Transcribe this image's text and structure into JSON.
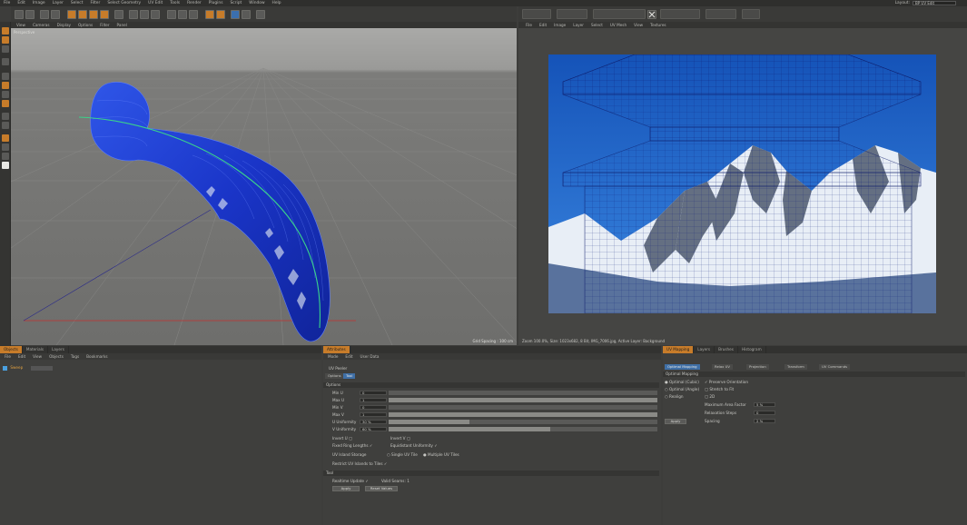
{
  "menubar": {
    "items": [
      "File",
      "Edit",
      "Image",
      "Layer",
      "Select",
      "Filter",
      "Select Geometry",
      "UV Edit",
      "Tools",
      "Render",
      "Plugins",
      "Script",
      "Window",
      "Help"
    ],
    "layout_label": "Layout:",
    "layout_value": "BP UV Edit"
  },
  "viewport": {
    "menu": [
      "View",
      "Cameras",
      "Display",
      "Options",
      "Filter",
      "Panel"
    ],
    "label": "Perspective",
    "grid_spacing": "Grid Spacing : 100 cm"
  },
  "uv_editor": {
    "menu": [
      "File",
      "Edit",
      "Image",
      "Layer",
      "Select",
      "UV Mesh",
      "View",
      "Textures"
    ],
    "status": "Zoom 100.0%, Size: 1023x682, 8 Bit, IMG_7006.jpg, Active Layer: Background"
  },
  "objects_panel": {
    "tabs": [
      "Objects",
      "Materials",
      "Layers"
    ],
    "menu": [
      "File",
      "Edit",
      "View",
      "Objects",
      "Tags",
      "Bookmarks"
    ],
    "object_name": "Sweep"
  },
  "attributes_panel": {
    "tabs": [
      "Attributes"
    ],
    "menu": [
      "Mode",
      "Edit",
      "User Data"
    ],
    "tool_title": "UV Peeler",
    "subtabs": [
      "Options",
      "Tool"
    ],
    "options_header": "Options",
    "fields": [
      {
        "label": "Min U",
        "value": "0"
      },
      {
        "label": "Max U",
        "value": "1"
      },
      {
        "label": "Min V",
        "value": "0"
      },
      {
        "label": "Max V",
        "value": "1"
      },
      {
        "label": "U Uniformity",
        "value": "30 %",
        "fill": 0.3
      },
      {
        "label": "V Uniformity",
        "value": "60 %",
        "fill": 0.6
      }
    ],
    "invert_u": "Invert U",
    "invert_v": "Invert V",
    "fixed_ring_lengths": "Fixed Ring Lengths",
    "equidistant_uniformity": "Equidistant Uniformity",
    "uv_island_storage": "UV Island Storage",
    "single_uv_tile": "Single UV Tile",
    "multiple_uv_tiles": "Multiple UV Tiles",
    "restrict_uv_islands": "Restrict UV Islands to Tiles",
    "tool_header": "Tool",
    "realtime_update": "Realtime Update",
    "valid_seams": "Valid Seams: 1",
    "apply_label": "Apply",
    "reset_label": "Reset Values"
  },
  "uv_manager": {
    "tabs": [
      "UV Mapping",
      "Layers",
      "Brushes",
      "Histogram"
    ],
    "subtabs": [
      "Optimal Mapping",
      "Relax UV",
      "Projection",
      "Transform",
      "UV Commands"
    ],
    "header": "Optimal Mapping",
    "radio_cubic": "Optimal (Cubic)",
    "radio_angle": "Optimal (Angle)",
    "radio_realign": "Realign",
    "preserve": "Preserve Orientation",
    "stretch": "Stretch to Fit",
    "equalize": "2D",
    "max_area_label": "Maximum Area Factor",
    "max_area_value": "5 %",
    "relax_label": "Relaxation Steps",
    "relax_value": "0",
    "spacing_label": "Spacing",
    "spacing_value": "2 %",
    "apply_label": "Apply"
  },
  "colors": {
    "accent": "#c77c2a",
    "selection": "#3f6fa6",
    "mesh": "#1a3fd6",
    "sky": "#1c5fbe"
  }
}
